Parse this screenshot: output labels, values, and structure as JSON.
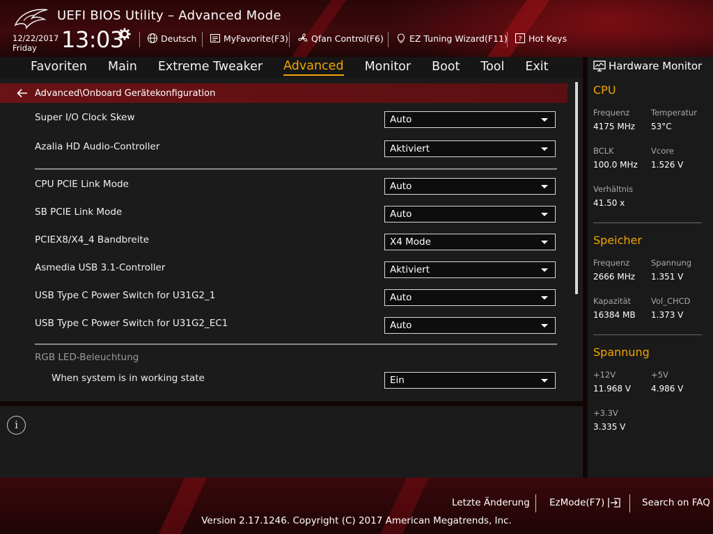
{
  "header": {
    "title": "UEFI BIOS Utility – Advanced Mode",
    "date": "12/22/2017",
    "weekday": "Friday",
    "time": "13:03",
    "toolbar": {
      "language": "Deutsch",
      "myfavorite": "MyFavorite(F3)",
      "qfan": "Qfan Control(F6)",
      "ez_tuning": "EZ Tuning Wizard(F11)",
      "hotkeys": "Hot Keys"
    }
  },
  "menu": {
    "items": [
      "Favoriten",
      "Main",
      "Extreme Tweaker",
      "Advanced",
      "Monitor",
      "Boot",
      "Tool",
      "Exit"
    ],
    "active": "Advanced"
  },
  "breadcrumb": "Advanced\\Onboard Gerätekonfiguration",
  "settings": {
    "super_io_clock_skew": {
      "label": "Super I/O Clock Skew",
      "value": "Auto"
    },
    "azalia_hd_audio": {
      "label": "Azalia HD Audio-Controller",
      "value": "Aktiviert"
    },
    "cpu_pcie_link_mode": {
      "label": "CPU PCIE Link Mode",
      "value": "Auto"
    },
    "sb_pcie_link_mode": {
      "label": "SB PCIE Link Mode",
      "value": "Auto"
    },
    "pciex8_x4_4_bandwidth": {
      "label": "PCIEX8/X4_4 Bandbreite",
      "value": "X4 Mode"
    },
    "asmedia_usb31": {
      "label": "Asmedia USB 3.1-Controller",
      "value": "Aktiviert"
    },
    "usb_typec_u31g2_1": {
      "label": "USB Type C Power Switch for U31G2_1",
      "value": "Auto"
    },
    "usb_typec_u31g2_ec1": {
      "label": "USB Type C Power Switch for U31G2_EC1",
      "value": "Auto"
    },
    "rgb_section": "RGB LED-Beleuchtung",
    "working_state": {
      "label": "When system is in working state",
      "value": "Ein"
    }
  },
  "info_icon": "info-icon",
  "hardware_monitor": {
    "title": "Hardware Monitor",
    "cpu": {
      "title": "CPU",
      "frequency_label": "Frequenz",
      "frequency": "4175 MHz",
      "temperature_label": "Temperatur",
      "temperature": "53°C",
      "bclk_label": "BCLK",
      "bclk": "100.0 MHz",
      "vcore_label": "Vcore",
      "vcore": "1.526 V",
      "ratio_label": "Verhältnis",
      "ratio": "41.50 x"
    },
    "memory": {
      "title": "Speicher",
      "frequency_label": "Frequenz",
      "frequency": "2666 MHz",
      "voltage_label": "Spannung",
      "voltage": "1.351 V",
      "capacity_label": "Kapazität",
      "capacity": "16384 MB",
      "vol_chcd_label": "Vol_CHCD",
      "vol_chcd": "1.373 V"
    },
    "voltage": {
      "title": "Spannung",
      "p12v_label": "+12V",
      "p12v": "11.968 V",
      "p5v_label": "+5V",
      "p5v": "4.986 V",
      "p33v_label": "+3.3V",
      "p33v": "3.335 V"
    }
  },
  "footer": {
    "last_change": "Letzte Änderung",
    "ezmode": "EzMode(F7)",
    "faq": "Search on FAQ",
    "copyright": "Version 2.17.1246. Copyright (C) 2017 American Megatrends, Inc."
  },
  "colors": {
    "accent": "#f2a500",
    "breadcrumb_bg": "#6a1214",
    "panel_bg": "#1b1b1b"
  }
}
